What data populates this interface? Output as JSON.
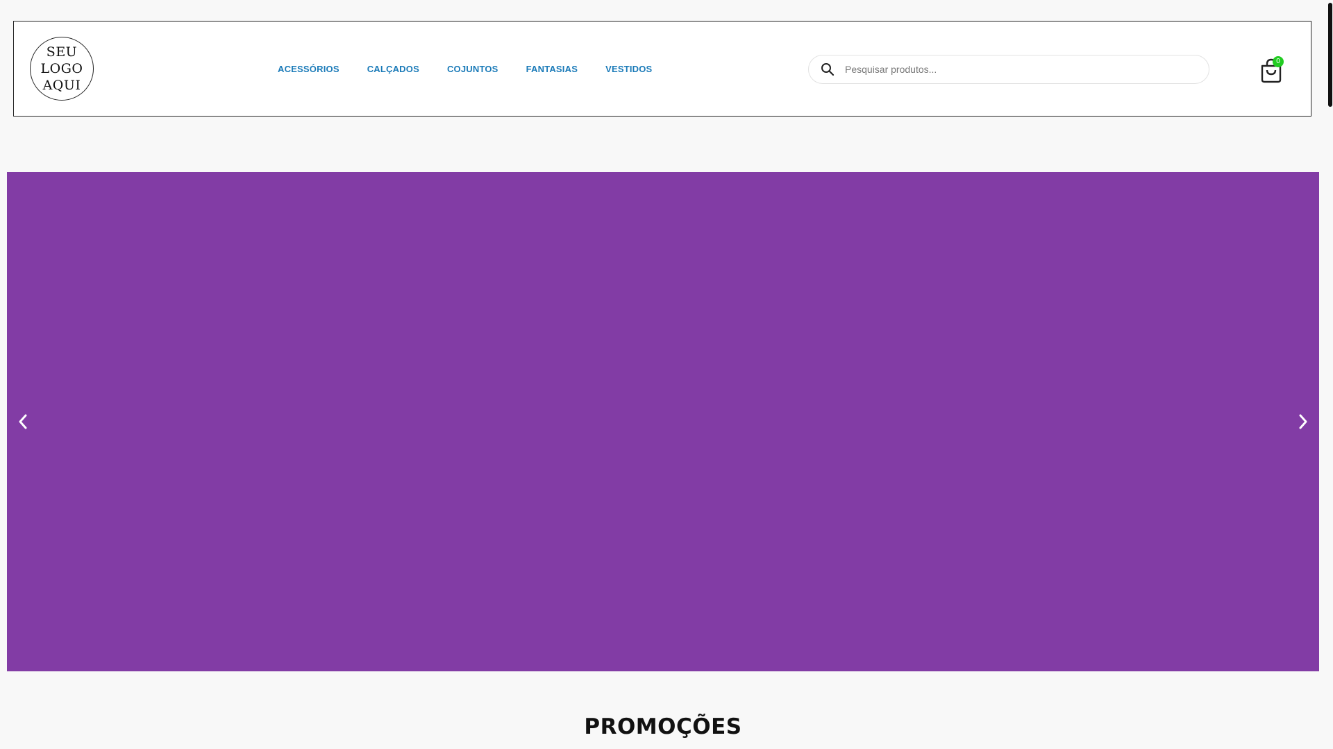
{
  "header": {
    "logo_lines": [
      "SEU",
      "LOGO",
      "AQUI"
    ],
    "nav": [
      {
        "label": "ACESSÓRIOS"
      },
      {
        "label": "CALÇADOS"
      },
      {
        "label": "COJUNTOS"
      },
      {
        "label": "FANTASIAS"
      },
      {
        "label": "VESTIDOS"
      }
    ],
    "search": {
      "placeholder": "Pesquisar produtos...",
      "icon": "search-icon"
    },
    "cart": {
      "icon": "shopping-bag-icon",
      "count": "0"
    }
  },
  "slider": {
    "background_color": "#823ca5",
    "prev_icon": "chevron-left-icon",
    "next_icon": "chevron-right-icon"
  },
  "sections": {
    "promotions_title": "PROMOÇÕES"
  },
  "colors": {
    "nav_link": "#1a7ab8",
    "cart_badge": "#22cc22",
    "banner": "#823ca5"
  }
}
